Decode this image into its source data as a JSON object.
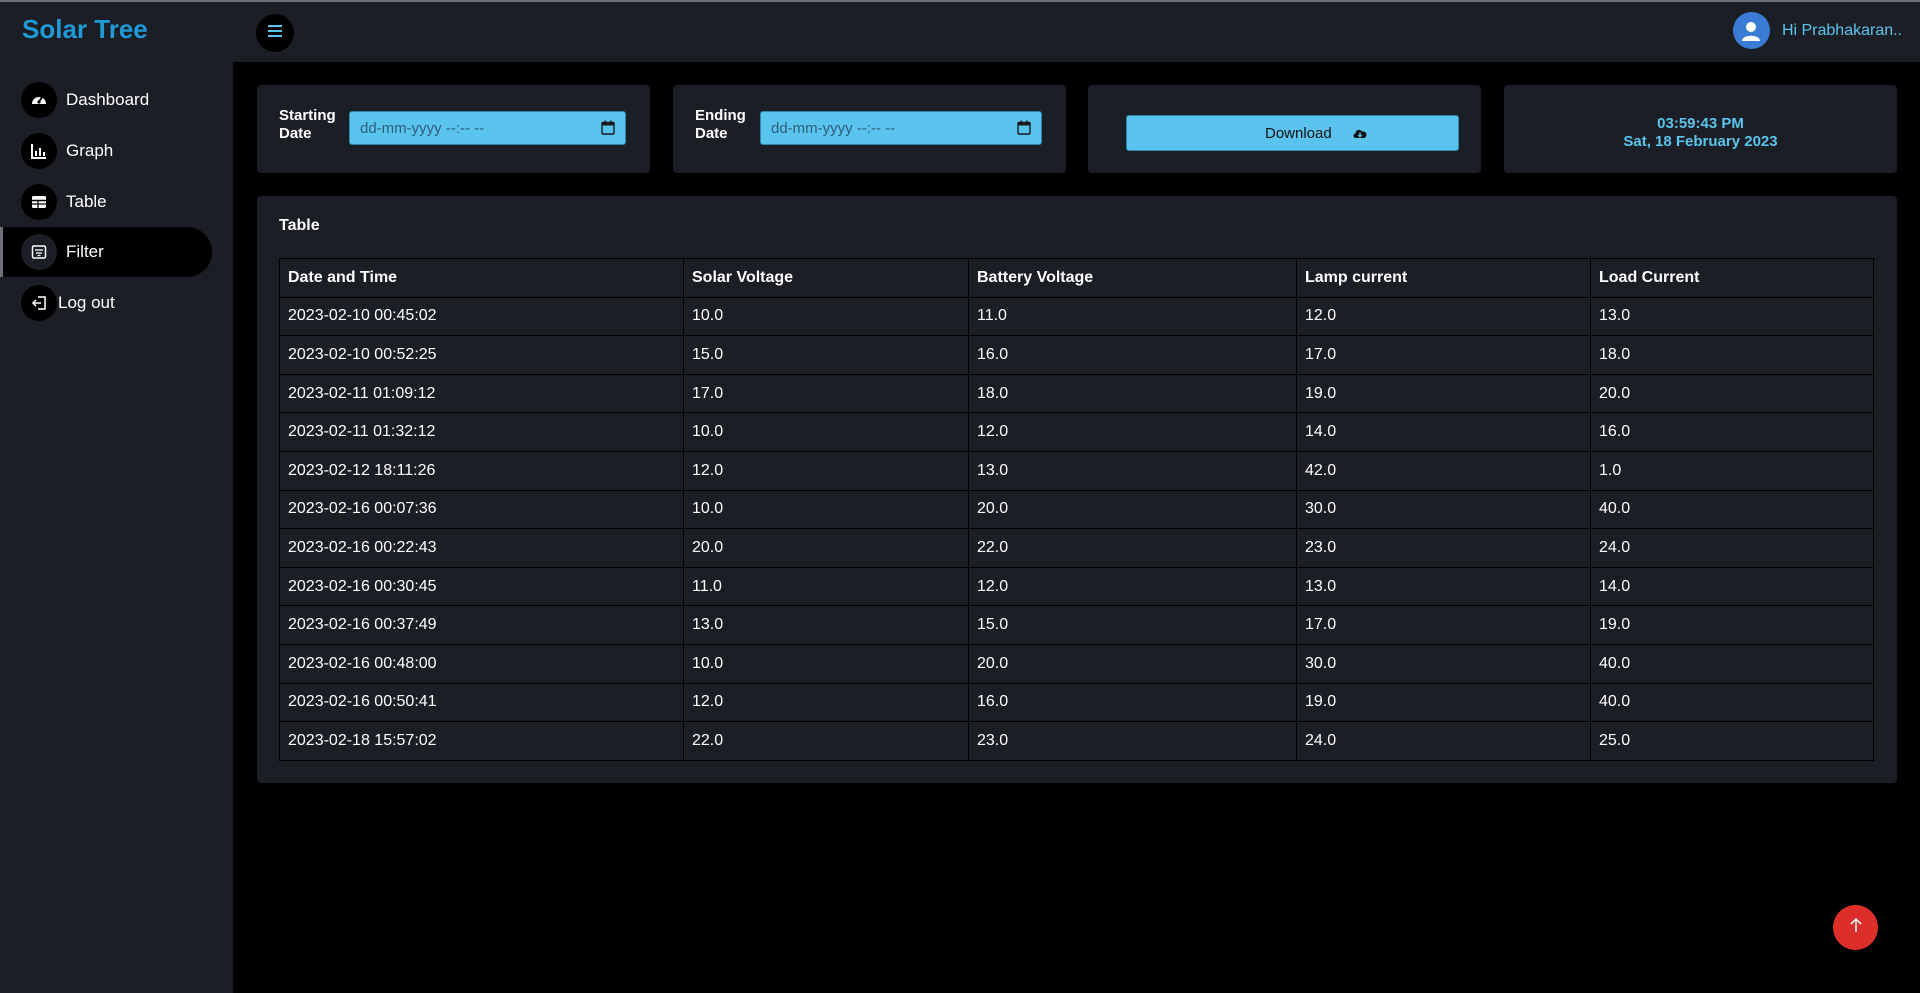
{
  "brand": "Solar Tree",
  "sidebar": {
    "items": [
      {
        "label": "Dashboard"
      },
      {
        "label": "Graph"
      },
      {
        "label": "Table"
      },
      {
        "label": "Filter"
      },
      {
        "label": "Log out"
      }
    ]
  },
  "header": {
    "greeting": "Hi Prabhakaran.."
  },
  "filters": {
    "start_label_1": "Starting",
    "start_label_2": "Date",
    "start_placeholder": "dd-mm-yyyy --:-- --",
    "end_label_1": "Ending",
    "end_label_2": "Date",
    "end_placeholder": "dd-mm-yyyy --:-- --",
    "download_label": "Download"
  },
  "clock": {
    "time": "03:59:43 PM",
    "date": "Sat, 18 February 2023"
  },
  "table": {
    "title": "Table",
    "columns": [
      "Date and Time",
      "Solar Voltage",
      "Battery Voltage",
      "Lamp current",
      "Load Current"
    ],
    "rows": [
      [
        "2023-02-10 00:45:02",
        "10.0",
        "11.0",
        "12.0",
        "13.0"
      ],
      [
        "2023-02-10 00:52:25",
        "15.0",
        "16.0",
        "17.0",
        "18.0"
      ],
      [
        "2023-02-11 01:09:12",
        "17.0",
        "18.0",
        "19.0",
        "20.0"
      ],
      [
        "2023-02-11 01:32:12",
        "10.0",
        "12.0",
        "14.0",
        "16.0"
      ],
      [
        "2023-02-12 18:11:26",
        "12.0",
        "13.0",
        "42.0",
        "1.0"
      ],
      [
        "2023-02-16 00:07:36",
        "10.0",
        "20.0",
        "30.0",
        "40.0"
      ],
      [
        "2023-02-16 00:22:43",
        "20.0",
        "22.0",
        "23.0",
        "24.0"
      ],
      [
        "2023-02-16 00:30:45",
        "11.0",
        "12.0",
        "13.0",
        "14.0"
      ],
      [
        "2023-02-16 00:37:49",
        "13.0",
        "15.0",
        "17.0",
        "19.0"
      ],
      [
        "2023-02-16 00:48:00",
        "10.0",
        "20.0",
        "30.0",
        "40.0"
      ],
      [
        "2023-02-16 00:50:41",
        "12.0",
        "16.0",
        "19.0",
        "40.0"
      ],
      [
        "2023-02-18 15:57:02",
        "22.0",
        "23.0",
        "24.0",
        "25.0"
      ]
    ]
  },
  "colors": {
    "accent": "#5bc4ee",
    "brand": "#1f9ad6",
    "panel": "#1b1e24",
    "scroll_top": "#dc2f2a"
  },
  "icons": {
    "dashboard": "speedometer-icon",
    "graph": "bar-chart-icon",
    "table": "table-icon",
    "filter": "filter-icon",
    "logout": "logout-icon",
    "menu": "hamburger-icon",
    "download": "cloud-download-icon",
    "calendar": "calendar-icon",
    "scroll_top": "arrow-up-icon"
  }
}
